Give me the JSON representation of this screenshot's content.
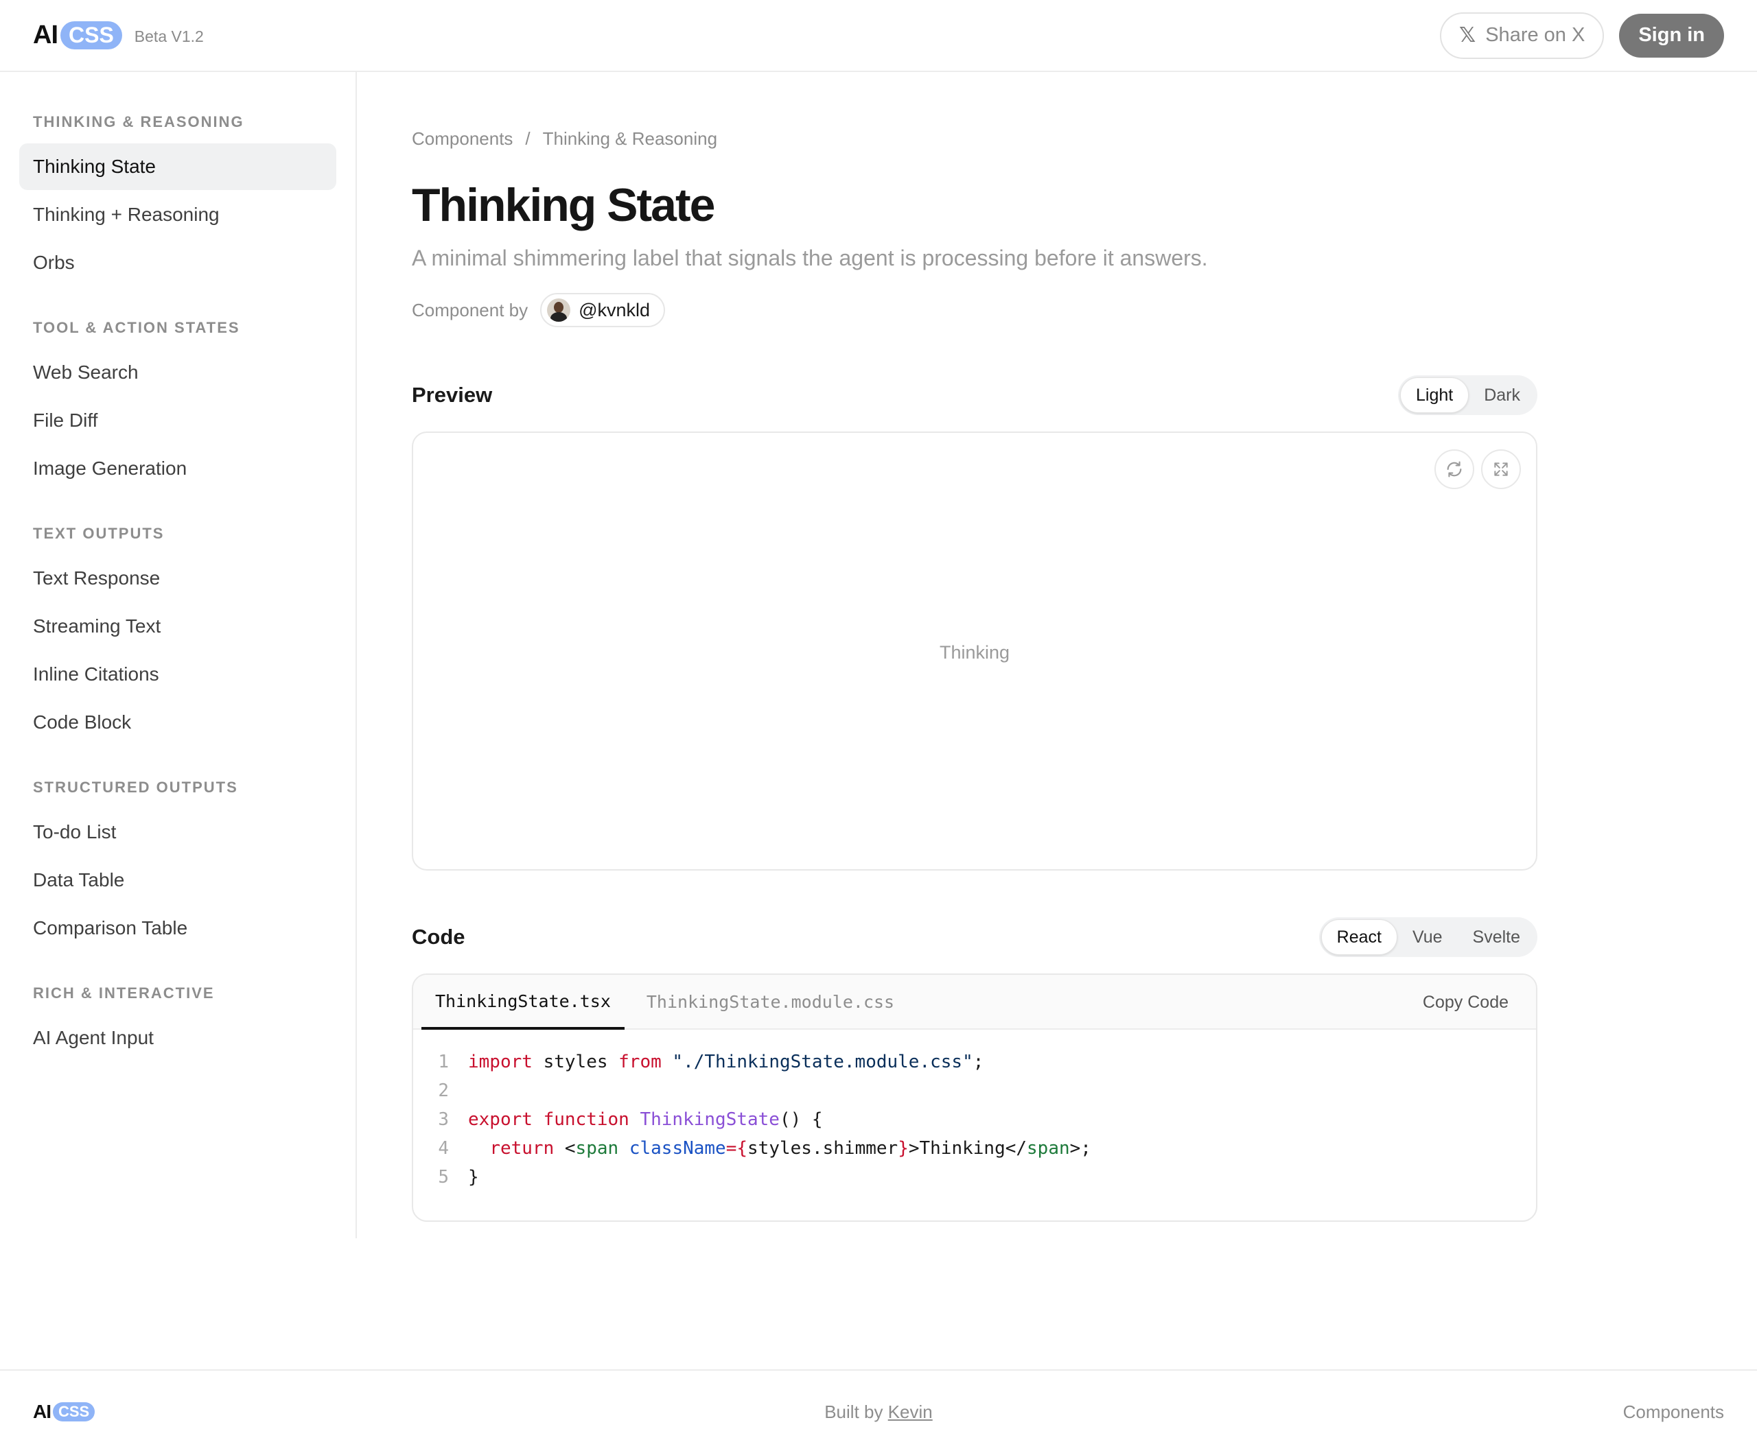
{
  "header": {
    "logo_ai": "AI",
    "logo_css": "CSS",
    "beta": "Beta V1.2",
    "share_label": "Share on X",
    "share_icon": "x-logo-icon",
    "signin_label": "Sign in"
  },
  "sidebar": {
    "sections": [
      {
        "title": "THINKING & REASONING",
        "items": [
          "Thinking State",
          "Thinking + Reasoning",
          "Orbs"
        ]
      },
      {
        "title": "TOOL & ACTION STATES",
        "items": [
          "Web Search",
          "File Diff",
          "Image Generation"
        ]
      },
      {
        "title": "TEXT OUTPUTS",
        "items": [
          "Text Response",
          "Streaming Text",
          "Inline Citations",
          "Code Block"
        ]
      },
      {
        "title": "STRUCTURED OUTPUTS",
        "items": [
          "To-do List",
          "Data Table",
          "Comparison Table"
        ]
      },
      {
        "title": "RICH & INTERACTIVE",
        "items": [
          "AI Agent Input"
        ]
      }
    ],
    "active_item": "Thinking State"
  },
  "main": {
    "breadcrumb": [
      "Components",
      "Thinking & Reasoning"
    ],
    "breadcrumb_sep": "/",
    "title": "Thinking State",
    "subtitle": "A minimal shimmering label that signals the agent is processing before it answers.",
    "byline_label": "Component by",
    "author": "@kvnkld",
    "preview": {
      "heading": "Preview",
      "themes": [
        "Light",
        "Dark"
      ],
      "active_theme": "Light",
      "demo_text": "Thinking",
      "icons": [
        "refresh-icon",
        "expand-icon"
      ]
    },
    "code": {
      "heading": "Code",
      "frameworks": [
        "React",
        "Vue",
        "Svelte"
      ],
      "active_framework": "React",
      "files": [
        "ThinkingState.tsx",
        "ThinkingState.module.css"
      ],
      "active_file": "ThinkingState.tsx",
      "copy_label": "Copy Code",
      "line_numbers": [
        "1",
        "2",
        "3",
        "4",
        "5"
      ]
    }
  },
  "footer": {
    "logo_ai": "AI",
    "logo_css": "CSS",
    "built_prefix": "Built by",
    "built_name": "Kevin",
    "link": "Components"
  },
  "colors": {
    "accent_logo": "#8fb4f7",
    "signin_bg": "#777777",
    "keyword": "#c8102e",
    "function": "#8a4fd6",
    "tag": "#1d7a3a",
    "attribute": "#1a52c4"
  }
}
